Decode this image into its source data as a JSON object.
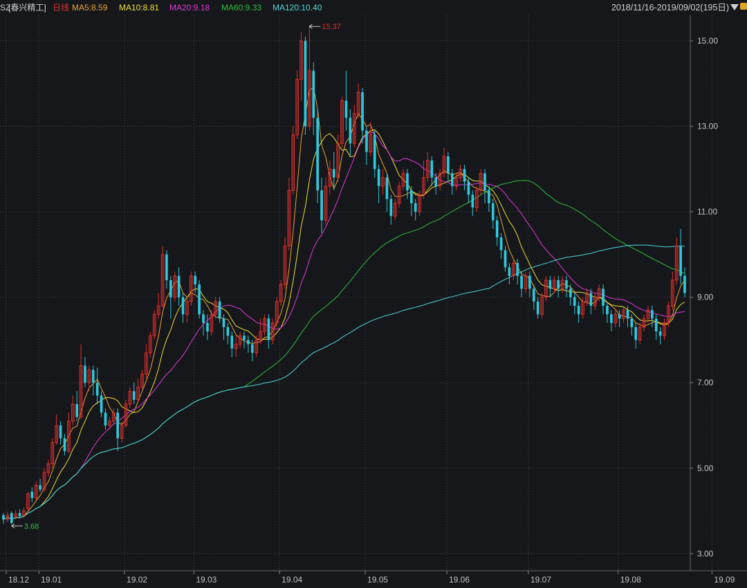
{
  "header": {
    "ticker_prefix": "SZ",
    "stock_name": "[春兴精工]",
    "period": "日线",
    "ma": [
      {
        "label": "MA5:8.59",
        "color": "#e8a33a"
      },
      {
        "label": "MA10:8.81",
        "color": "#f0e03a"
      },
      {
        "label": "MA20:9.18",
        "color": "#e23ad9"
      },
      {
        "label": "MA60:9.33",
        "color": "#2fbf3a"
      },
      {
        "label": "MA120:10.40",
        "color": "#4fd7dc"
      }
    ],
    "date_range": "2018/11/16-2019/09/02(195日)"
  },
  "icons": {
    "dropdown": "triangle-down-icon",
    "lock": "lock-icon"
  },
  "colors": {
    "up": "#e0302e",
    "down": "#2fc9dc",
    "grid": "#4a4a4a",
    "bg": "#16171b"
  },
  "chart_data": {
    "type": "candlestick",
    "ylim": [
      2.6,
      15.6
    ],
    "y_ticks": [
      "15.00",
      "13.00",
      "11.00",
      "9.00",
      "7.00",
      "5.00",
      "3.00"
    ],
    "x_ticks": [
      "18.12",
      "19.01",
      "19.02",
      "19.03",
      "19.04",
      "19.05",
      "19.06",
      "19.07",
      "19.08",
      "19.09"
    ],
    "annotations": {
      "high": "15.37",
      "low": "3.68"
    },
    "ma_values": {
      "MA5": 8.59,
      "MA10": 8.81,
      "MA20": 9.18,
      "MA60": 9.33,
      "MA120": 10.4
    },
    "candles": [
      [
        3.9,
        3.8,
        3.95,
        3.7
      ],
      [
        3.8,
        3.9,
        3.98,
        3.74
      ],
      [
        3.95,
        3.72,
        3.99,
        3.68
      ],
      [
        3.85,
        3.93,
        4.02,
        3.8
      ],
      [
        3.95,
        3.88,
        4.04,
        3.82
      ],
      [
        3.9,
        4.0,
        4.08,
        3.85
      ],
      [
        4.05,
        4.4,
        4.45,
        4.0
      ],
      [
        4.45,
        4.3,
        4.55,
        4.2
      ],
      [
        4.3,
        4.6,
        4.7,
        4.25
      ],
      [
        4.6,
        4.5,
        4.75,
        4.45
      ],
      [
        4.5,
        4.9,
        5.0,
        4.45
      ],
      [
        4.9,
        5.1,
        5.2,
        4.8
      ],
      [
        5.1,
        5.6,
        5.7,
        5.0
      ],
      [
        5.6,
        6.0,
        6.25,
        5.55
      ],
      [
        6.0,
        5.7,
        6.1,
        5.55
      ],
      [
        5.7,
        5.4,
        5.8,
        5.3
      ],
      [
        5.4,
        6.1,
        6.3,
        5.35
      ],
      [
        6.1,
        6.5,
        6.7,
        6.0
      ],
      [
        6.5,
        6.2,
        6.8,
        6.1
      ],
      [
        6.2,
        7.4,
        7.9,
        6.15
      ],
      [
        7.4,
        7.0,
        7.6,
        6.9
      ],
      [
        7.0,
        7.3,
        7.4,
        6.8
      ],
      [
        7.3,
        7.0,
        7.4,
        6.7
      ],
      [
        7.0,
        6.7,
        7.35,
        6.5
      ],
      [
        6.7,
        6.3,
        6.8,
        6.2
      ],
      [
        6.3,
        6.0,
        6.4,
        5.9
      ],
      [
        6.0,
        6.1,
        6.2,
        5.9
      ],
      [
        6.1,
        6.3,
        6.4,
        6.0
      ],
      [
        6.3,
        5.7,
        6.4,
        5.4
      ],
      [
        5.7,
        6.0,
        6.1,
        5.6
      ],
      [
        6.0,
        6.5,
        6.6,
        5.95
      ],
      [
        6.5,
        6.8,
        6.9,
        6.4
      ],
      [
        6.8,
        6.6,
        7.0,
        6.5
      ],
      [
        6.6,
        6.9,
        7.1,
        6.55
      ],
      [
        6.9,
        7.2,
        7.3,
        6.85
      ],
      [
        7.2,
        7.7,
        7.9,
        7.1
      ],
      [
        7.7,
        8.1,
        8.2,
        7.6
      ],
      [
        8.1,
        8.6,
        8.7,
        8.0
      ],
      [
        8.6,
        8.8,
        9.1,
        8.5
      ],
      [
        8.8,
        10.0,
        10.2,
        8.75
      ],
      [
        10.0,
        9.4,
        10.1,
        9.2
      ],
      [
        9.4,
        9.0,
        9.5,
        8.5
      ],
      [
        9.0,
        9.5,
        9.6,
        8.9
      ],
      [
        9.5,
        9.0,
        9.7,
        8.8
      ],
      [
        9.0,
        8.6,
        9.1,
        8.4
      ],
      [
        8.6,
        8.9,
        9.0,
        8.4
      ],
      [
        8.9,
        9.5,
        9.6,
        8.8
      ],
      [
        9.5,
        9.3,
        9.6,
        9.1
      ],
      [
        9.3,
        8.6,
        9.4,
        8.5
      ],
      [
        8.6,
        8.4,
        8.7,
        8.1
      ],
      [
        8.4,
        8.2,
        8.6,
        8.0
      ],
      [
        8.2,
        8.6,
        8.7,
        8.1
      ],
      [
        8.6,
        8.9,
        9.0,
        8.5
      ],
      [
        8.9,
        8.5,
        9.0,
        8.4
      ],
      [
        8.5,
        8.3,
        8.6,
        8.0
      ],
      [
        8.3,
        8.1,
        8.4,
        7.9
      ],
      [
        8.1,
        7.8,
        8.2,
        7.6
      ],
      [
        7.8,
        7.9,
        8.1,
        7.6
      ],
      [
        7.9,
        8.1,
        8.2,
        7.8
      ],
      [
        8.1,
        8.0,
        8.2,
        7.8
      ],
      [
        8.0,
        7.9,
        8.1,
        7.7
      ],
      [
        7.9,
        7.7,
        8.0,
        7.5
      ],
      [
        7.7,
        8.0,
        8.1,
        7.6
      ],
      [
        8.0,
        8.2,
        8.5,
        7.9
      ],
      [
        8.2,
        8.5,
        8.6,
        8.1
      ],
      [
        8.5,
        8.0,
        8.6,
        7.8
      ],
      [
        8.0,
        8.4,
        8.5,
        7.9
      ],
      [
        8.4,
        8.9,
        9.0,
        8.3
      ],
      [
        8.9,
        9.3,
        9.4,
        8.8
      ],
      [
        9.3,
        10.2,
        10.4,
        9.2
      ],
      [
        10.2,
        11.5,
        11.8,
        10.1
      ],
      [
        11.5,
        12.8,
        13.0,
        11.4
      ],
      [
        12.8,
        14.1,
        14.3,
        12.7
      ],
      [
        14.1,
        15.0,
        15.2,
        13.6
      ],
      [
        15.0,
        13.0,
        15.1,
        12.8
      ],
      [
        13.0,
        14.3,
        15.37,
        12.9
      ],
      [
        14.3,
        13.2,
        14.5,
        12.8
      ],
      [
        13.2,
        11.5,
        13.4,
        11.2
      ],
      [
        11.5,
        10.8,
        11.8,
        10.5
      ],
      [
        10.8,
        11.6,
        11.8,
        10.7
      ],
      [
        11.6,
        12.0,
        12.2,
        11.4
      ],
      [
        12.0,
        11.8,
        12.4,
        11.5
      ],
      [
        11.8,
        12.6,
        12.8,
        11.7
      ],
      [
        12.6,
        13.6,
        13.7,
        12.5
      ],
      [
        13.6,
        13.2,
        14.3,
        12.9
      ],
      [
        13.2,
        12.6,
        13.4,
        12.3
      ],
      [
        12.6,
        13.3,
        13.5,
        12.5
      ],
      [
        13.3,
        13.8,
        14.0,
        13.2
      ],
      [
        13.8,
        12.9,
        13.9,
        12.6
      ],
      [
        12.9,
        12.4,
        13.0,
        12.1
      ],
      [
        12.4,
        12.8,
        13.1,
        12.3
      ],
      [
        12.8,
        12.0,
        12.9,
        11.8
      ],
      [
        12.0,
        11.6,
        12.1,
        11.2
      ],
      [
        11.6,
        11.8,
        12.0,
        11.4
      ],
      [
        11.8,
        11.3,
        11.9,
        11.0
      ],
      [
        11.3,
        10.9,
        11.4,
        10.7
      ],
      [
        10.9,
        11.2,
        11.3,
        10.8
      ],
      [
        11.2,
        11.6,
        11.7,
        11.1
      ],
      [
        11.6,
        11.9,
        12.0,
        11.5
      ],
      [
        11.9,
        11.5,
        12.0,
        11.3
      ],
      [
        11.5,
        11.2,
        11.6,
        10.9
      ],
      [
        11.2,
        11.0,
        11.3,
        10.8
      ],
      [
        11.0,
        11.4,
        11.5,
        10.9
      ],
      [
        11.4,
        11.8,
        12.2,
        11.3
      ],
      [
        11.8,
        12.2,
        12.4,
        11.7
      ],
      [
        12.2,
        11.8,
        12.3,
        11.6
      ],
      [
        11.8,
        11.6,
        11.9,
        11.4
      ],
      [
        11.6,
        11.9,
        12.0,
        11.5
      ],
      [
        11.9,
        12.3,
        12.5,
        11.8
      ],
      [
        12.3,
        11.9,
        12.4,
        11.7
      ],
      [
        11.9,
        11.6,
        12.0,
        11.4
      ],
      [
        11.6,
        11.8,
        11.9,
        11.5
      ],
      [
        11.8,
        12.0,
        12.1,
        11.7
      ],
      [
        12.0,
        11.7,
        12.1,
        11.5
      ],
      [
        11.7,
        11.4,
        11.8,
        11.2
      ],
      [
        11.4,
        11.1,
        11.5,
        10.9
      ],
      [
        11.1,
        11.5,
        11.6,
        11.0
      ],
      [
        11.5,
        11.9,
        12.0,
        11.4
      ],
      [
        11.9,
        11.5,
        12.0,
        11.2
      ],
      [
        11.5,
        11.2,
        11.6,
        11.0
      ],
      [
        11.2,
        10.8,
        11.3,
        10.6
      ],
      [
        10.8,
        10.4,
        10.9,
        10.2
      ],
      [
        10.4,
        10.1,
        10.5,
        9.9
      ],
      [
        10.1,
        9.7,
        10.2,
        9.6
      ],
      [
        9.7,
        9.5,
        9.8,
        9.3
      ],
      [
        9.5,
        9.8,
        9.9,
        9.4
      ],
      [
        9.8,
        9.5,
        9.9,
        9.3
      ],
      [
        9.5,
        9.2,
        9.6,
        9.0
      ],
      [
        9.2,
        9.5,
        9.6,
        9.1
      ],
      [
        9.5,
        9.2,
        9.6,
        9.0
      ],
      [
        9.2,
        8.9,
        9.3,
        8.7
      ],
      [
        8.9,
        8.6,
        9.0,
        8.5
      ],
      [
        8.6,
        9.0,
        9.1,
        8.5
      ],
      [
        9.0,
        9.4,
        9.5,
        8.9
      ],
      [
        9.4,
        9.2,
        9.5,
        9.0
      ],
      [
        9.2,
        9.4,
        9.5,
        9.1
      ],
      [
        9.4,
        9.2,
        9.5,
        9.0
      ],
      [
        9.2,
        9.4,
        9.5,
        9.1
      ],
      [
        9.4,
        9.2,
        9.5,
        9.0
      ],
      [
        9.2,
        9.0,
        9.3,
        8.8
      ],
      [
        9.0,
        8.8,
        9.1,
        8.6
      ],
      [
        8.8,
        8.6,
        8.9,
        8.4
      ],
      [
        8.6,
        8.9,
        9.0,
        8.5
      ],
      [
        8.9,
        9.1,
        9.2,
        8.8
      ],
      [
        9.1,
        8.8,
        9.2,
        8.6
      ],
      [
        8.8,
        9.0,
        9.1,
        8.7
      ],
      [
        9.0,
        9.2,
        9.3,
        8.9
      ],
      [
        9.2,
        8.8,
        9.3,
        8.6
      ],
      [
        8.8,
        8.6,
        8.9,
        8.4
      ],
      [
        8.6,
        8.4,
        8.7,
        8.2
      ],
      [
        8.4,
        8.6,
        8.7,
        8.3
      ],
      [
        8.6,
        8.5,
        8.7,
        8.3
      ],
      [
        8.5,
        8.7,
        8.8,
        8.4
      ],
      [
        8.7,
        8.5,
        8.8,
        8.3
      ],
      [
        8.5,
        8.3,
        8.6,
        8.1
      ],
      [
        8.3,
        8.0,
        8.4,
        7.8
      ],
      [
        8.0,
        8.3,
        8.4,
        7.9
      ],
      [
        8.3,
        8.5,
        8.6,
        8.2
      ],
      [
        8.5,
        8.7,
        8.8,
        8.4
      ],
      [
        8.7,
        8.5,
        8.8,
        8.3
      ],
      [
        8.5,
        8.2,
        8.6,
        8.0
      ],
      [
        8.2,
        8.1,
        8.3,
        7.9
      ],
      [
        8.1,
        8.4,
        8.5,
        8.0
      ],
      [
        8.4,
        8.8,
        8.9,
        8.3
      ],
      [
        8.8,
        9.4,
        9.6,
        8.7
      ],
      [
        9.4,
        10.2,
        10.4,
        9.3
      ],
      [
        10.2,
        9.5,
        10.6,
        9.3
      ],
      [
        9.5,
        9.1,
        9.7,
        9.0
      ]
    ],
    "series": [
      {
        "name": "MA5",
        "color": "#e8a33a"
      },
      {
        "name": "MA10",
        "color": "#f0e03a"
      },
      {
        "name": "MA20",
        "color": "#e23ad9"
      },
      {
        "name": "MA60",
        "color": "#2fbf3a"
      },
      {
        "name": "MA120",
        "color": "#4fd7dc"
      }
    ]
  }
}
